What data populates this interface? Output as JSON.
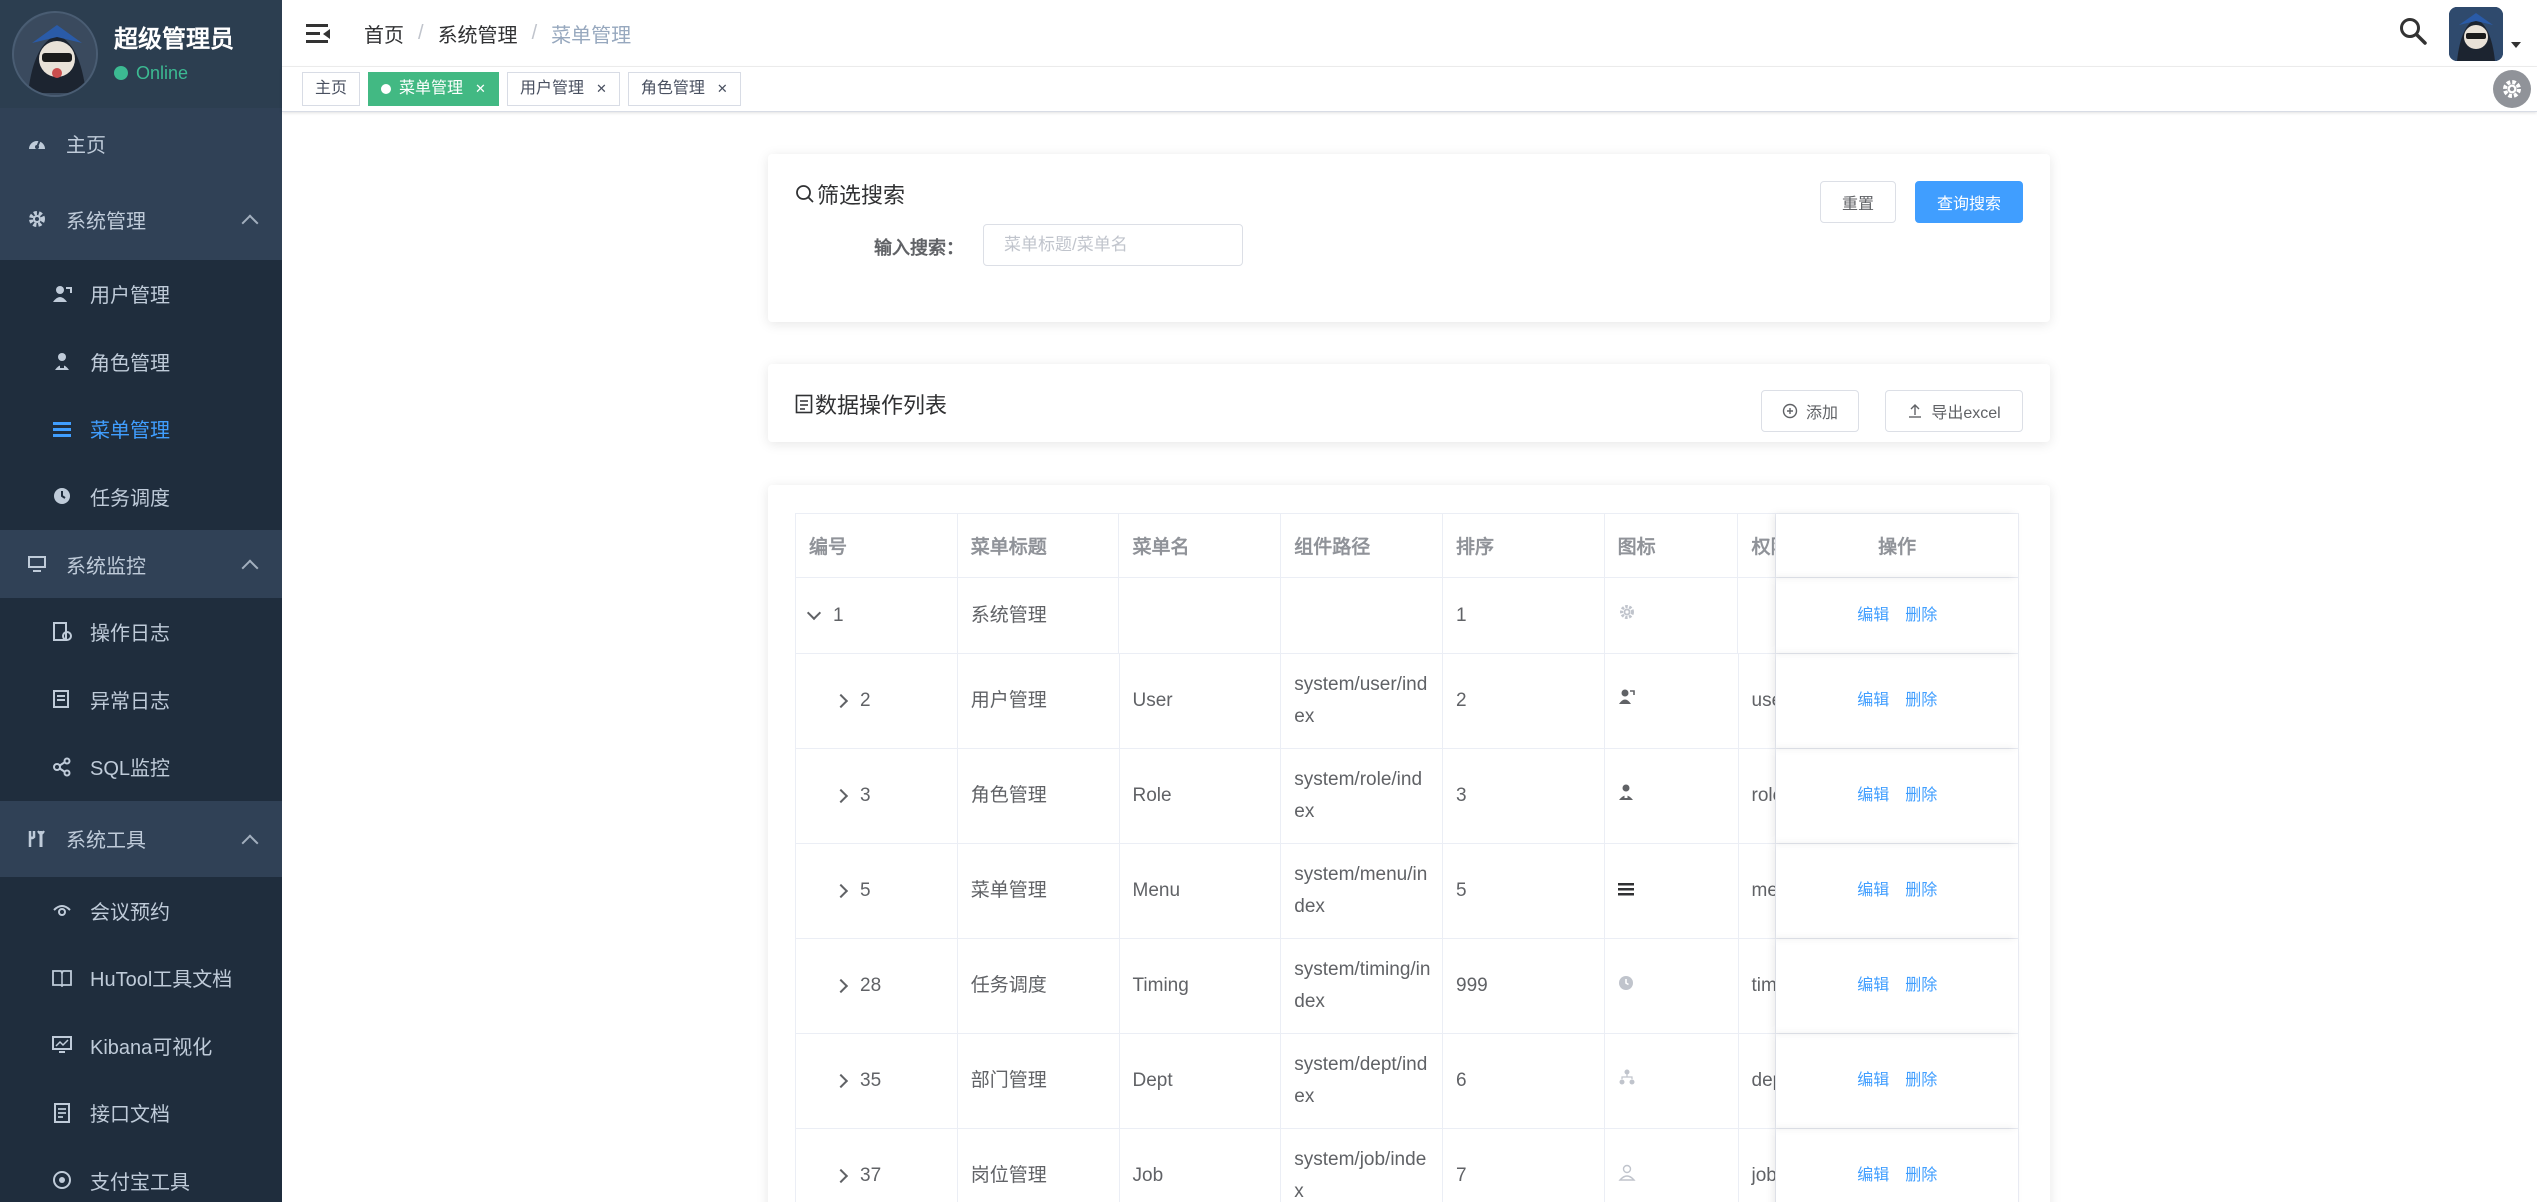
{
  "user": {
    "name": "超级管理员",
    "status": "Online"
  },
  "sidebar": {
    "home": "主页",
    "groups": [
      {
        "label": "系统管理",
        "icon": "gear-icon",
        "items": [
          {
            "label": "用户管理",
            "icon": "user-icon"
          },
          {
            "label": "角色管理",
            "icon": "role-icon"
          },
          {
            "label": "菜单管理",
            "icon": "menu-icon",
            "active": true
          },
          {
            "label": "任务调度",
            "icon": "clock-icon"
          }
        ]
      },
      {
        "label": "系统监控",
        "icon": "monitor-icon",
        "items": [
          {
            "label": "操作日志",
            "icon": "log-icon"
          },
          {
            "label": "异常日志",
            "icon": "error-log-icon"
          },
          {
            "label": "SQL监控",
            "icon": "sql-icon"
          }
        ]
      },
      {
        "label": "系统工具",
        "icon": "tools-icon",
        "items": [
          {
            "label": "会议预约",
            "icon": "meeting-icon"
          },
          {
            "label": "HuTool工具文档",
            "icon": "book-icon"
          },
          {
            "label": "Kibana可视化",
            "icon": "chart-icon"
          },
          {
            "label": "接口文档",
            "icon": "doc-icon"
          },
          {
            "label": "支付宝工具",
            "icon": "alipay-icon"
          }
        ]
      }
    ]
  },
  "breadcrumb": [
    "首页",
    "系统管理",
    "菜单管理"
  ],
  "tags": [
    {
      "label": "主页",
      "active": false,
      "closable": false
    },
    {
      "label": "菜单管理",
      "active": true,
      "closable": true
    },
    {
      "label": "用户管理",
      "active": false,
      "closable": true
    },
    {
      "label": "角色管理",
      "active": false,
      "closable": true
    }
  ],
  "search": {
    "title": "筛选搜索",
    "label": "输入搜索：",
    "placeholder": "菜单标题/菜单名",
    "reset": "重置",
    "submit": "查询搜索"
  },
  "list": {
    "title": "数据操作列表",
    "add": "添加",
    "export": "导出excel"
  },
  "table": {
    "headers": [
      "编号",
      "菜单标题",
      "菜单名",
      "组件路径",
      "排序",
      "图标",
      "权限",
      "操作"
    ],
    "actions": {
      "edit": "编辑",
      "delete": "删除"
    },
    "rows": [
      {
        "id": "1",
        "title": "系统管理",
        "name": "",
        "path": "",
        "sort": "1",
        "icon": "gear-icon",
        "perm": "",
        "expanded": true
      },
      {
        "id": "2",
        "title": "用户管理",
        "name": "User",
        "path": "system/user/index",
        "sort": "2",
        "icon": "user-icon",
        "perm": "user"
      },
      {
        "id": "3",
        "title": "角色管理",
        "name": "Role",
        "path": "system/role/index",
        "sort": "3",
        "icon": "role-icon",
        "perm": "role"
      },
      {
        "id": "5",
        "title": "菜单管理",
        "name": "Menu",
        "path": "system/menu/index",
        "sort": "5",
        "icon": "menu-icon",
        "perm": "menu"
      },
      {
        "id": "28",
        "title": "任务调度",
        "name": "Timing",
        "path": "system/timing/index",
        "sort": "999",
        "icon": "clock-icon",
        "perm": "timing"
      },
      {
        "id": "35",
        "title": "部门管理",
        "name": "Dept",
        "path": "system/dept/index",
        "sort": "6",
        "icon": "dept-icon",
        "perm": "dept"
      },
      {
        "id": "37",
        "title": "岗位管理",
        "name": "Job",
        "path": "system/job/index",
        "sort": "7",
        "icon": "job-icon",
        "perm": "job"
      }
    ]
  },
  "colors": {
    "sidebar": "#304156",
    "active": "#409eff",
    "tagActive": "#42b983",
    "online": "#3cba92"
  }
}
